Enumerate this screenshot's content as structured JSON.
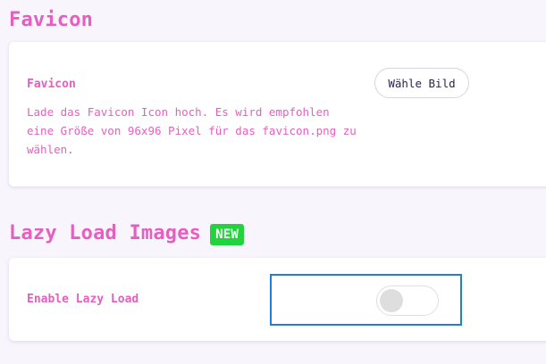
{
  "favicon_section": {
    "title": "Favicon",
    "label": "Favicon",
    "description": "Lade das Favicon Icon hoch. Es wird empfohlen eine Größe von 96x96 Pixel für das favicon.png zu wählen.",
    "button_label": "Wähle Bild"
  },
  "lazy_load_section": {
    "title": "Lazy Load Images",
    "badge": "NEW",
    "label": "Enable Lazy Load",
    "toggle_enabled": false
  },
  "colors": {
    "accent": "#e55fc0",
    "badge": "#22d33d",
    "focus_outline": "#1e7fd9",
    "background": "#f8f5fd"
  }
}
